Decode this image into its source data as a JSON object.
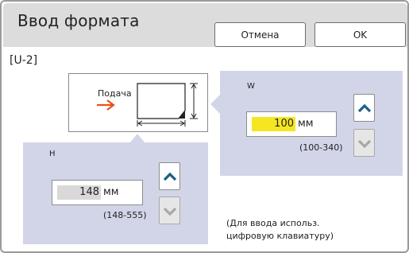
{
  "dialog": {
    "title": "Ввод формата",
    "cancel_label": "Отмена",
    "ok_label": "OK"
  },
  "section_code": "[U-2]",
  "diagram": {
    "feed_label": "Подача"
  },
  "w_field": {
    "label": "W",
    "value": "100",
    "unit": "мм",
    "range": "(100-340)"
  },
  "h_field": {
    "label": "H",
    "value": "148",
    "unit": "мм",
    "range": "(148-555)"
  },
  "hint": {
    "line1": "(Для ввода использ.",
    "line2": "цифровую клавиатуру)"
  },
  "colors": {
    "panel": "#d2d5e8",
    "active_value": "#f5e621",
    "inactive_value": "#d9d9d9",
    "arrow_active": "#1b5f86",
    "arrow_disabled": "#a8a8a8",
    "feed_arrow": "#e8501a"
  }
}
